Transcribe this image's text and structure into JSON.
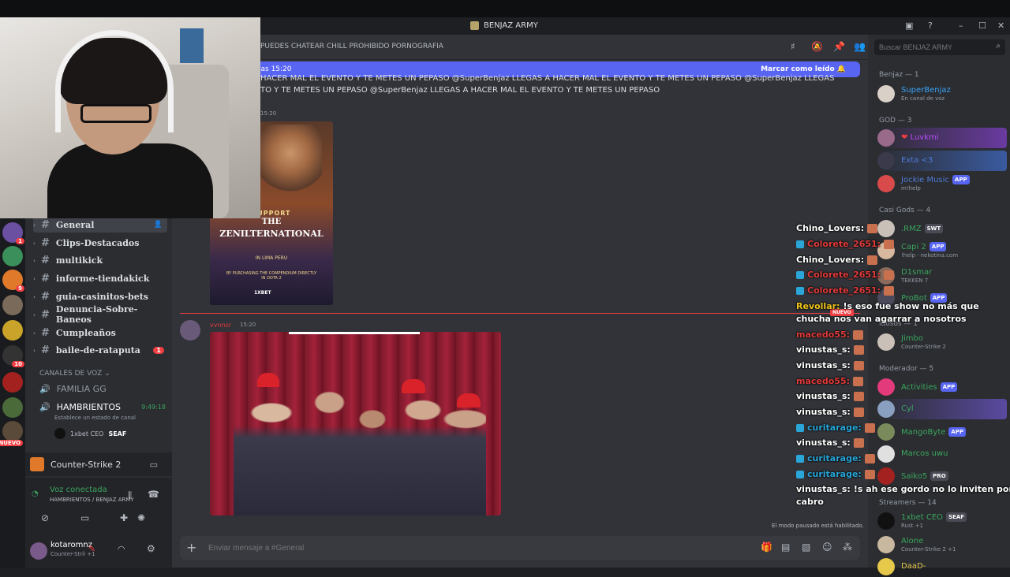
{
  "window": {
    "title": "BENJAZ ARMY"
  },
  "channel": {
    "topic": "PUEDES CHATEAR CHILL PROHIBIDO PORNOGRAFIA",
    "name": "General"
  },
  "new_banner": {
    "text": "las 15:20",
    "action": "Marcar como leído"
  },
  "messages": {
    "spam_line1": "HACER MAL EL EVENTO Y TE METES UN PEPASO @SuperBenjaz LLEGAS A HACER MAL EL EVENTO Y TE METES UN PEPASO @SuperBenjaz LLEGAS A HACER",
    "spam_line2": "TO Y TE METES UN PEPASO @SuperBenjaz LLEGAS A HACER MAL EL EVENTO Y TE METES UN PEPASO",
    "time1": "15:20",
    "poster_support": "SUPPORT",
    "poster_the": "THE",
    "poster_title": "ZENILTERNATIONAL",
    "poster_loc": "IN LIMA PERU",
    "poster_sub": "BY PURCHASING THE COMPENDIUM DIRECTLY IN DOTA 2",
    "poster_brand": "1XBET",
    "new_tag": "NUEVO",
    "author2": "vvnnsr",
    "time2": "15:20"
  },
  "slowmode": "El modo pausado está habilitado.",
  "composer": {
    "placeholder": "Enviar mensaje a #General"
  },
  "search": {
    "placeholder": "Buscar BENJAZ ARMY"
  },
  "channels": {
    "text": [
      "General",
      "Clips-Destacados",
      "multikick",
      "informe-tiendakick",
      "guia-casinitos-bets",
      "Denuncia-Sobre-Baneos",
      "Cumpleaños",
      "baile-de-rataputa"
    ],
    "unread_badge": "1",
    "voice_header": "CANALES DE VOZ",
    "voice": [
      "FAMILIA GG",
      "HAMBRIENTOS"
    ],
    "voice_time": "9:49:18",
    "voice_status": "Establece un estado de canal",
    "voice_user": "1xbet CEO",
    "voice_user_tag": "SEAF"
  },
  "activity": {
    "game": "Counter-Strike 2"
  },
  "voice_panel": {
    "status": "Voz conectada",
    "location": "HAMBRIENTOS / BENJAZ ARMY"
  },
  "user_panel": {
    "name": "kotaromnz",
    "status": "Counter-Stril +1"
  },
  "guild_badges": [
    "1",
    "9",
    "10",
    "NUEVO"
  ],
  "members": {
    "groups": [
      {
        "header": "Benjaz — 1"
      },
      {
        "header": "GOD — 3"
      },
      {
        "header": "Casi Gods — 4"
      },
      {
        "header": "Moderador — 5"
      },
      {
        "header": "Streamers — 14"
      }
    ],
    "list": [
      {
        "name": "SuperBenjaz",
        "sub": "En canal de voz",
        "color": "#3ba3f5"
      },
      {
        "name": "Luvkmi",
        "sub": "",
        "color": "#b54cf5"
      },
      {
        "name": "Exta <3",
        "sub": "",
        "color": "#4f7ad9"
      },
      {
        "name": "Jockie Music",
        "sub": "m!help",
        "color": "#4f7ad9",
        "badge": "APP"
      },
      {
        "name": ".RMZ",
        "sub": "",
        "color": "#3ba55d",
        "badge": "SWT"
      },
      {
        "name": "Capi 2",
        "sub": "!help · nekotina.com",
        "color": "#3ba55d",
        "badge": "APP"
      },
      {
        "name": "D1smar",
        "sub": "TEKKEN 7",
        "color": "#3ba55d"
      },
      {
        "name": "ProBot",
        "sub": "",
        "color": "#3ba55d",
        "badge": "APP"
      },
      {
        "name": "Jimbo",
        "sub": "Counter-Strike 2",
        "color": "#3ba55d"
      },
      {
        "name": "Activities",
        "sub": "",
        "color": "#3ba55d",
        "badge": "APP"
      },
      {
        "name": "Cyl",
        "sub": "",
        "color": "#3ba55d"
      },
      {
        "name": "MangoByte",
        "sub": "",
        "color": "#3ba55d",
        "badge": "APP"
      },
      {
        "name": "Marcos uwu",
        "sub": "",
        "color": "#3ba55d"
      },
      {
        "name": "Saiko5",
        "sub": "",
        "color": "#3ba55d",
        "badge": "PRO"
      },
      {
        "name": "1xbet CEO",
        "sub": "Rust +1",
        "color": "#3ba55d",
        "badge": "SEAF"
      },
      {
        "name": "Alone",
        "sub": "Counter-Strike 2 +1",
        "color": "#3ba55d"
      },
      {
        "name": "DaaD-",
        "sub": "",
        "color": "#e6c84a"
      }
    ],
    "obscured_header": "idosos — 1"
  },
  "overlay_chat": [
    {
      "user": "Chino_Lovers:",
      "color": "#ffffff",
      "text": ""
    },
    {
      "user": "Colorete_2651:",
      "color": "#e23a3a",
      "text": ""
    },
    {
      "user": "Chino_Lovers:",
      "color": "#ffffff",
      "text": ""
    },
    {
      "user": "Colorete_2651:",
      "color": "#e23a3a",
      "text": ""
    },
    {
      "user": "Colorete_2651:",
      "color": "#e23a3a",
      "text": ""
    },
    {
      "user": "Revollar:",
      "color": "#f0c419",
      "text": "!s eso fue show no más que"
    },
    {
      "user": "",
      "color": "#ffffff",
      "text": "chucha nos van agarrar a nosotros"
    },
    {
      "user": "macedo55:",
      "color": "#e23a3a",
      "text": ""
    },
    {
      "user": "vinustas_s:",
      "color": "#ffffff",
      "text": ""
    },
    {
      "user": "vinustas_s:",
      "color": "#ffffff",
      "text": ""
    },
    {
      "user": "macedo55:",
      "color": "#e23a3a",
      "text": ""
    },
    {
      "user": "vinustas_s:",
      "color": "#ffffff",
      "text": ""
    },
    {
      "user": "vinustas_s:",
      "color": "#ffffff",
      "text": ""
    },
    {
      "user": "curitarage:",
      "color": "#2aa6d9",
      "text": ""
    },
    {
      "user": "vinustas_s:",
      "color": "#ffffff",
      "text": ""
    },
    {
      "user": "curitarage:",
      "color": "#2aa6d9",
      "text": ""
    },
    {
      "user": "curitarage:",
      "color": "#2aa6d9",
      "text": ""
    },
    {
      "user": "vinustas_s:",
      "color": "#ffffff",
      "text": "!s ah ese gordo no lo inviten por"
    },
    {
      "user": "",
      "color": "#ffffff",
      "text": "cabro"
    }
  ]
}
